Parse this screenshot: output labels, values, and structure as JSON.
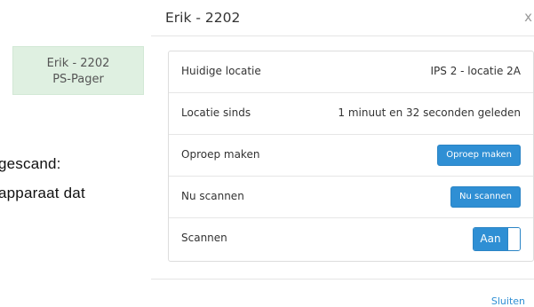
{
  "background": {
    "card_line1": "Erik - 2202",
    "card_line2": "PS-Pager",
    "text_line1": "gescand:",
    "text_line2": "apparaat dat"
  },
  "modal": {
    "title": "Erik - 2202",
    "close_glyph": "x",
    "rows": [
      {
        "label": "Huidige locatie",
        "value": "IPS 2 - locatie 2A"
      },
      {
        "label": "Locatie sinds",
        "value": "1 minuut en 32 seconden geleden"
      },
      {
        "label": "Oproep maken",
        "button": "Oproep maken"
      },
      {
        "label": "Nu scannen",
        "button": "Nu scannen"
      },
      {
        "label": "Scannen",
        "toggle": "Aan"
      }
    ],
    "footer_link": "Sluiten"
  },
  "colors": {
    "accent": "#2f8fd4",
    "card_bg": "#dff0e1"
  }
}
